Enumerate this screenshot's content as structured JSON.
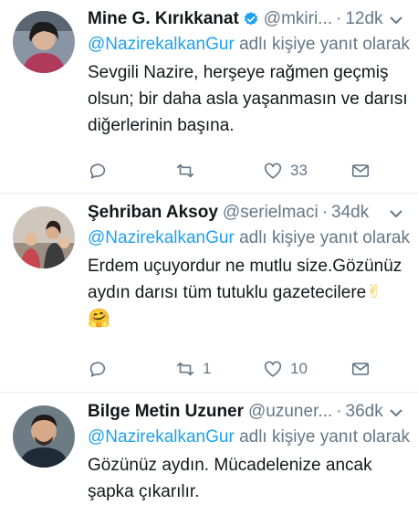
{
  "tweets": [
    {
      "display_name": "Mine G. Kırıkkanat",
      "verified": true,
      "handle": "@mkiri...",
      "dot": "·",
      "time": "12dk",
      "reply_mention": "@NazirekalkanGur",
      "reply_suffix": " adlı kişiye yanıt olarak",
      "text": "Sevgili Nazire, herşeye rağmen geçmiş olsun; bir daha asla yaşanmasın ve darısı diğerlerinin başına.",
      "reply_count": "",
      "retweet_count": "",
      "like_count": "33"
    },
    {
      "display_name": "Şehriban Aksoy",
      "verified": false,
      "handle": "@serielmaci",
      "dot": "·",
      "time": "34dk",
      "reply_mention": "@NazirekalkanGur",
      "reply_suffix": " adlı kişiye yanıt olarak",
      "text": "Erdem uçuyordur ne mutlu size.Gözünüz aydın darısı tüm tutuklu gazetecilere",
      "emoji_1": "✌",
      "emoji_2": "🤗",
      "reply_count": "",
      "retweet_count": "1",
      "like_count": "10"
    },
    {
      "display_name": "Bilge Metin Uzuner",
      "verified": false,
      "handle": "@uzuner...",
      "dot": "·",
      "time": "36dk",
      "reply_mention": "@NazirekalkanGur",
      "reply_suffix": " adlı kişiye yanıt olarak",
      "text": "Gözünüz aydın. Mücadelenize ancak şapka çıkarılır."
    }
  ],
  "icons": {
    "reply": "reply-icon",
    "retweet": "retweet-icon",
    "like": "heart-icon",
    "dm": "mail-icon",
    "more": "chevron-down-icon",
    "verified": "verified-badge-icon"
  },
  "colors": {
    "link": "#1da1f2",
    "muted": "#657786",
    "text": "#14171a",
    "divider": "#e6ecf0",
    "verified": "#1da1f2"
  }
}
